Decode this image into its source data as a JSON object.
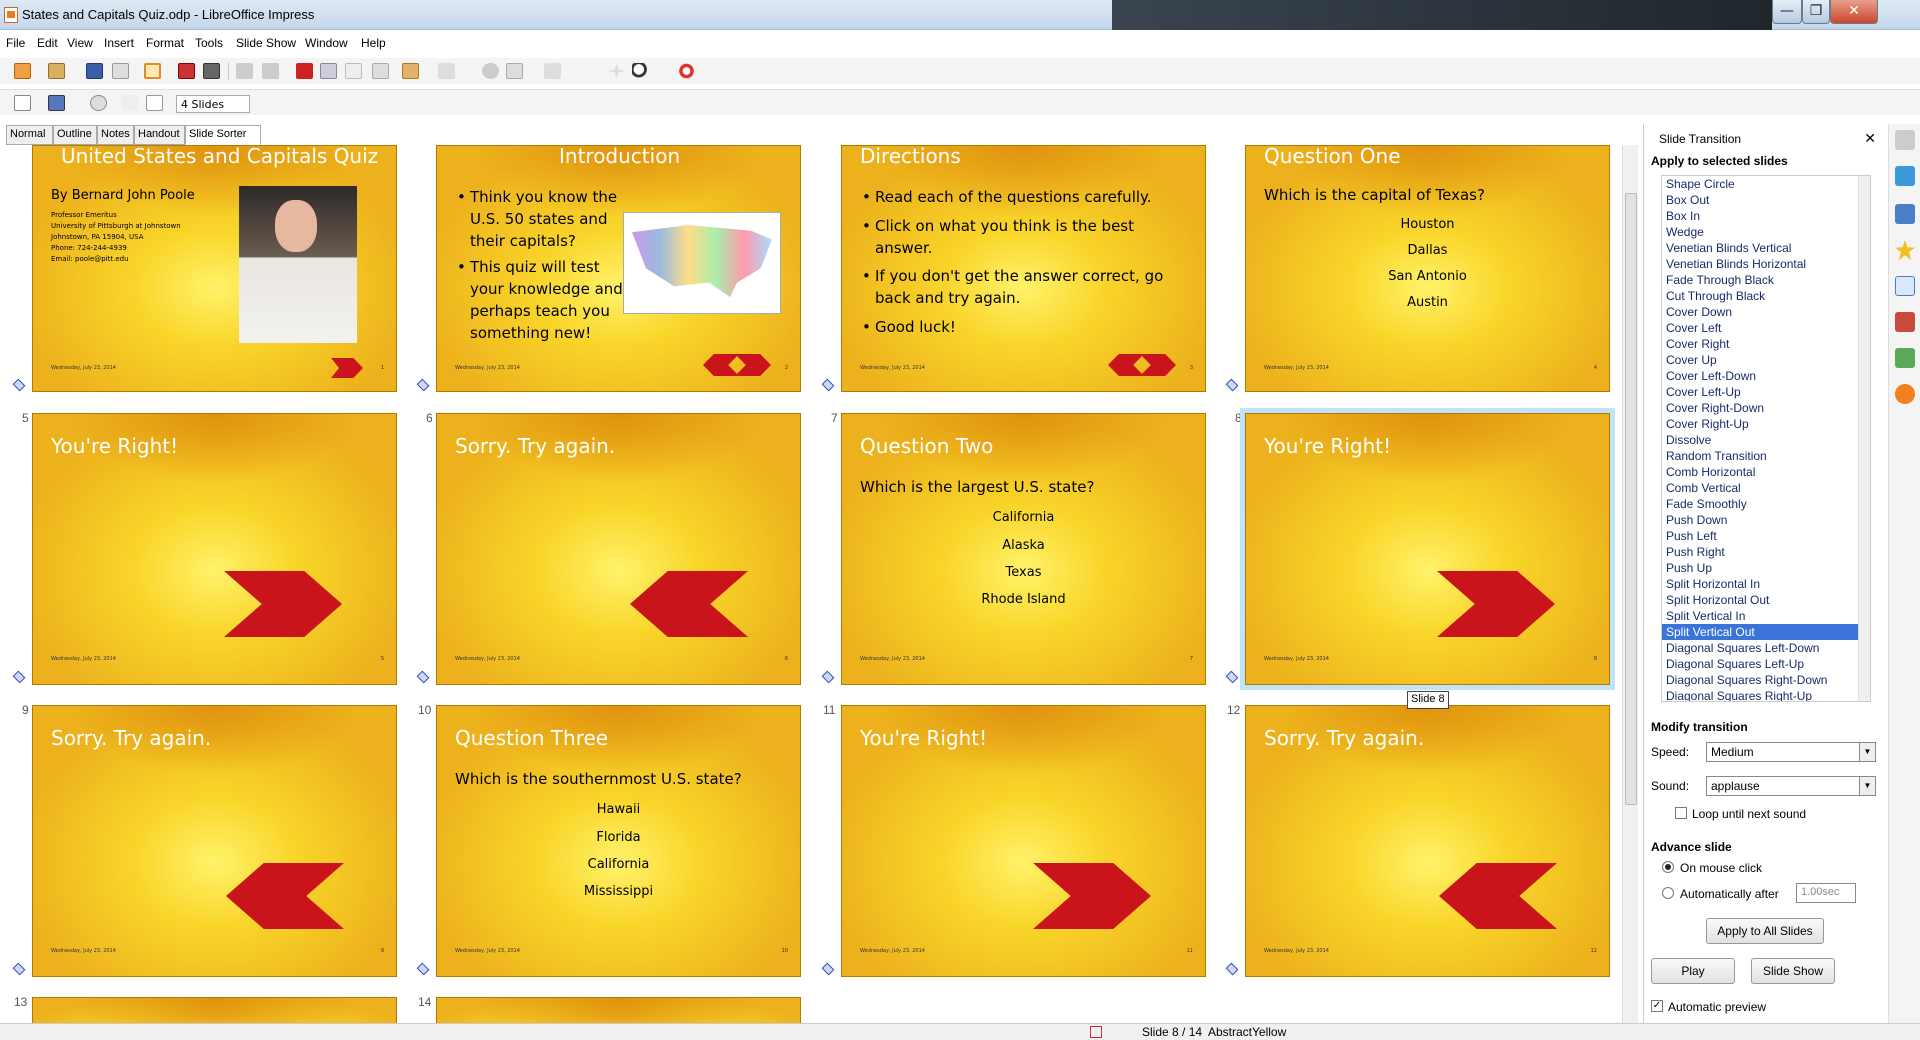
{
  "window": {
    "title": "States and Capitals Quiz.odp - LibreOffice Impress",
    "min": "—",
    "max": "❐",
    "close": "✕"
  },
  "menu": [
    "File",
    "Edit",
    "View",
    "Insert",
    "Format",
    "Tools",
    "Slide Show",
    "Window",
    "Help"
  ],
  "toolbar": {
    "slide_count": "4 Slides"
  },
  "view_tabs": [
    "Normal",
    "Outline",
    "Notes",
    "Handout",
    "Slide Sorter"
  ],
  "slides": {
    "s1": {
      "title": "United States and Capitals Quiz",
      "author": "By Bernard John Poole",
      "info": [
        "Professor Emeritus",
        "University of Pittsburgh at Johnstown",
        "Johnstown, PA 15904, USA",
        "Phone: 724-244-4939",
        "Email: poole@pitt.edu"
      ],
      "date": "Wednesday, July 23, 2014",
      "num": "1"
    },
    "s2": {
      "title": "Introduction",
      "bullets": [
        "Think you know the U.S. 50 states and their capitals?",
        "This quiz will test your knowledge and perhaps teach you something new!"
      ],
      "date": "Wednesday, July 23, 2014",
      "num": "2"
    },
    "s3": {
      "title": "Directions",
      "bullets": [
        "Read each of the questions carefully.",
        "Click on what you think is the best answer.",
        "If you don't get the answer correct, go back and try again.",
        "Good luck!"
      ],
      "date": "Wednesday, July 23, 2014",
      "num": "3"
    },
    "s4": {
      "title": "Question One",
      "question": "Which is the capital of Texas?",
      "answers": [
        "Houston",
        "Dallas",
        "San Antonio",
        "Austin"
      ],
      "date": "Wednesday, July 23, 2014",
      "num": "4"
    },
    "s5": {
      "title": "You're Right!",
      "date": "Wednesday, July 23, 2014",
      "num": "5",
      "label": "5"
    },
    "s6": {
      "title": "Sorry. Try again.",
      "date": "Wednesday, July 23, 2014",
      "num": "6",
      "label": "6"
    },
    "s7": {
      "title": "Question Two",
      "question": "Which is the largest U.S. state?",
      "answers": [
        "California",
        "Alaska",
        "Texas",
        "Rhode Island"
      ],
      "date": "Wednesday, July 23, 2014",
      "num": "7",
      "label": "7"
    },
    "s8": {
      "title": "You're Right!",
      "date": "Wednesday, July 23, 2014",
      "num": "8",
      "label": "8"
    },
    "s9": {
      "title": "Sorry. Try again.",
      "date": "Wednesday, July 23, 2014",
      "num": "9",
      "label": "9"
    },
    "s10": {
      "title": "Question Three",
      "question": "Which is the southernmost U.S. state?",
      "answers": [
        "Hawaii",
        "Florida",
        "California",
        "Mississippi"
      ],
      "date": "Wednesday, July 23, 2014",
      "num": "10",
      "label": "10"
    },
    "s11": {
      "title": "You're Right!",
      "date": "Wednesday, July 23, 2014",
      "num": "11",
      "label": "11"
    },
    "s12": {
      "title": "Sorry. Try again.",
      "date": "Wednesday, July 23, 2014",
      "num": "12",
      "label": "12"
    },
    "s13": {
      "label": "13"
    },
    "s14": {
      "label": "14"
    }
  },
  "tooltip": "Slide 8",
  "panel": {
    "title": "Slide Transition",
    "close": "✕",
    "apply_label": "Apply to selected slides",
    "transitions": [
      "Shape Circle",
      "Box Out",
      "Box In",
      "Wedge",
      "Venetian Blinds Vertical",
      "Venetian Blinds Horizontal",
      "Fade Through Black",
      "Cut Through Black",
      "Cover Down",
      "Cover Left",
      "Cover Right",
      "Cover Up",
      "Cover Left-Down",
      "Cover Left-Up",
      "Cover Right-Down",
      "Cover Right-Up",
      "Dissolve",
      "Random Transition",
      "Comb Horizontal",
      "Comb Vertical",
      "Fade Smoothly",
      "Push Down",
      "Push Left",
      "Push Right",
      "Push Up",
      "Split Horizontal In",
      "Split Horizontal Out",
      "Split Vertical In",
      "Split Vertical Out",
      "Diagonal Squares Left-Down",
      "Diagonal Squares Left-Up",
      "Diagonal Squares Right-Down",
      "Diagonal Squares Right-Up"
    ],
    "selected_transition": "Split Vertical Out",
    "modify_heading": "Modify transition",
    "speed_label": "Speed:",
    "speed_value": "Medium",
    "sound_label": "Sound:",
    "sound_value": "applause",
    "loop_label": "Loop until next sound",
    "advance_heading": "Advance slide",
    "on_click_label": "On mouse click",
    "auto_label": "Automatically after",
    "auto_value": "1.00sec",
    "apply_all": "Apply to All Slides",
    "play": "Play",
    "slideshow": "Slide Show",
    "auto_preview": "Automatic preview"
  },
  "status": {
    "slide": "Slide 8 / 14",
    "design": "AbstractYellow"
  },
  "colors": {
    "slide_yellow": "#f5c81e",
    "arrow_red": "#c9141c",
    "selection": "#3b74d8"
  }
}
